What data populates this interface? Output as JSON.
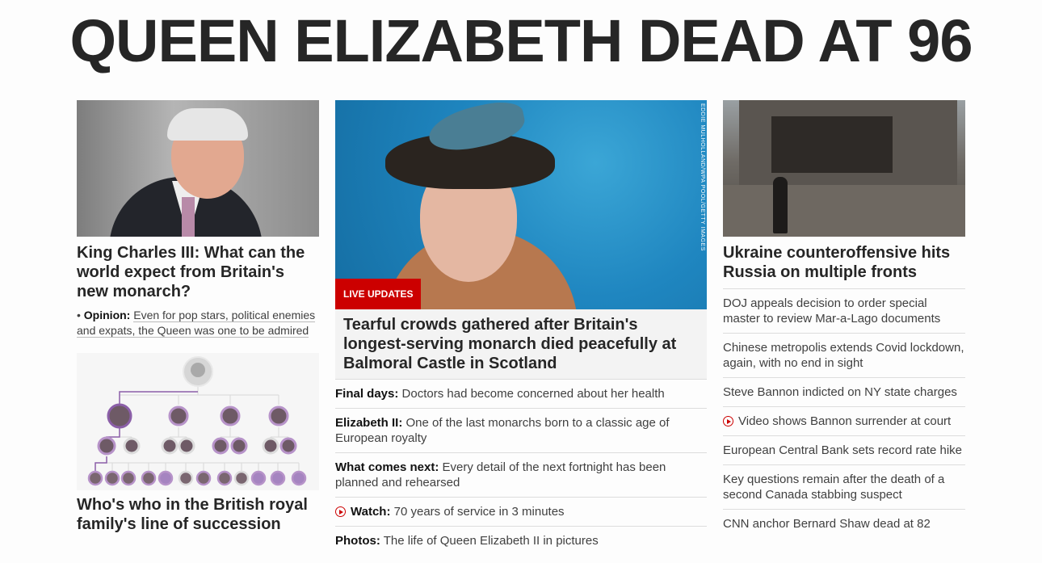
{
  "headline": "QUEEN ELIZABETH DEAD AT 96",
  "left": {
    "lead_title": "King Charles III: What can the world expect from Britain's new monarch?",
    "opinion_label": "Opinion:",
    "opinion_text": "Even for pop stars, political enemies and expats, the Queen was one to be admired",
    "tree_title": "Who's who in the British royal family's line of succession"
  },
  "center": {
    "photo_credit": "EDDIE MULHOLLAND/WPA POOL/GETTY IMAGES",
    "live_badge": "LIVE UPDATES",
    "lead_title": "Tearful crowds gathered after Britain's longest-serving monarch died peacefully at Balmoral Castle in Scotland",
    "items": [
      {
        "label": "Final days:",
        "text": "Doctors had become concerned about her health"
      },
      {
        "label": "Elizabeth II:",
        "text": "One of the last monarchs born to a classic age of European royalty"
      },
      {
        "label": "What comes next:",
        "text": "Every detail of the next fortnight has been planned and rehearsed"
      },
      {
        "label": "Watch:",
        "text": "70 years of service in 3 minutes",
        "icon": "play-icon"
      },
      {
        "label": "Photos:",
        "text": "The life of Queen Elizabeth II in pictures"
      }
    ]
  },
  "right": {
    "lead_title": "Ukraine counteroffensive hits Russia on multiple fronts",
    "items": [
      "DOJ appeals decision to order special master to review Mar-a-Lago documents",
      "Chinese metropolis extends Covid lockdown, again, with no end in sight",
      "Steve Bannon indicted on NY state charges",
      "Video shows Bannon surrender at court",
      "European Central Bank sets record rate hike",
      "Key questions remain after the death of a second Canada stabbing suspect",
      "CNN anchor Bernard Shaw dead at 82"
    ]
  },
  "colors": {
    "accent": "#cc0000",
    "text": "#262626",
    "tree_line": "#8b5fa8",
    "avatar_ring": "#b793c9"
  }
}
